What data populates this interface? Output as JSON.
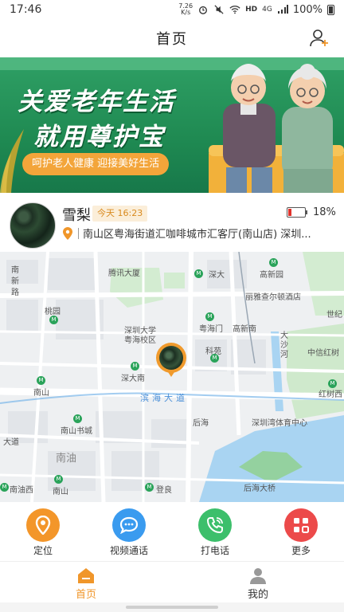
{
  "status_bar": {
    "time": "17:46",
    "speed_value": "7.26",
    "speed_unit": "K/s",
    "network": "HD",
    "signal": "4G",
    "battery": "100%"
  },
  "header": {
    "title": "首页",
    "add_user_icon": "add-user-icon"
  },
  "banner": {
    "headline_1": "关爱老年生活",
    "headline_2": "就用尊护宝",
    "tagline": "呵护老人健康  迎接美好生活"
  },
  "profile": {
    "name": "雪梨",
    "time_badge": "今天 16:23",
    "battery_level": 0.18,
    "battery_text": "18%",
    "address": "南山区粤海街道汇咖啡城市汇客厅(南山店) 深圳..."
  },
  "map": {
    "labels": [
      {
        "text": "腾讯大厦"
      },
      {
        "text": "深大"
      },
      {
        "text": "高新园"
      },
      {
        "text": "丽雅查尔顿酒店"
      },
      {
        "text": "南"
      },
      {
        "text": "新"
      },
      {
        "text": "路"
      },
      {
        "text": "桃园"
      },
      {
        "text": "深圳大学"
      },
      {
        "text": "粤海校区"
      },
      {
        "text": "粤海门"
      },
      {
        "text": "高新南"
      },
      {
        "text": "世纪"
      },
      {
        "text": "大"
      },
      {
        "text": "沙"
      },
      {
        "text": "河"
      },
      {
        "text": "中信红树"
      },
      {
        "text": "科苑"
      },
      {
        "text": "深大南"
      },
      {
        "text": "南山"
      },
      {
        "text": "红树西"
      },
      {
        "text": "滨海大道"
      },
      {
        "text": "后海"
      },
      {
        "text": "深圳湾体育中心"
      },
      {
        "text": "南山书城"
      },
      {
        "text": "大道"
      },
      {
        "text": "南油"
      },
      {
        "text": "南油西"
      },
      {
        "text": "南山"
      },
      {
        "text": "登良"
      },
      {
        "text": "后海大桥"
      }
    ]
  },
  "actions": [
    {
      "label": "定位",
      "icon": "location-icon",
      "color": "#f3962a"
    },
    {
      "label": "视频通话",
      "icon": "chat-bubble-icon",
      "color": "#3a9bef"
    },
    {
      "label": "打电话",
      "icon": "phone-icon",
      "color": "#3cbf6b"
    },
    {
      "label": "更多",
      "icon": "grid-icon",
      "color": "#ec4a4a"
    }
  ],
  "bottom_nav": {
    "home": {
      "label": "首页",
      "icon": "home-icon",
      "color": "#f0962a",
      "active": true
    },
    "mine": {
      "label": "我的",
      "icon": "user-icon",
      "color": "#666666",
      "active": false
    }
  }
}
